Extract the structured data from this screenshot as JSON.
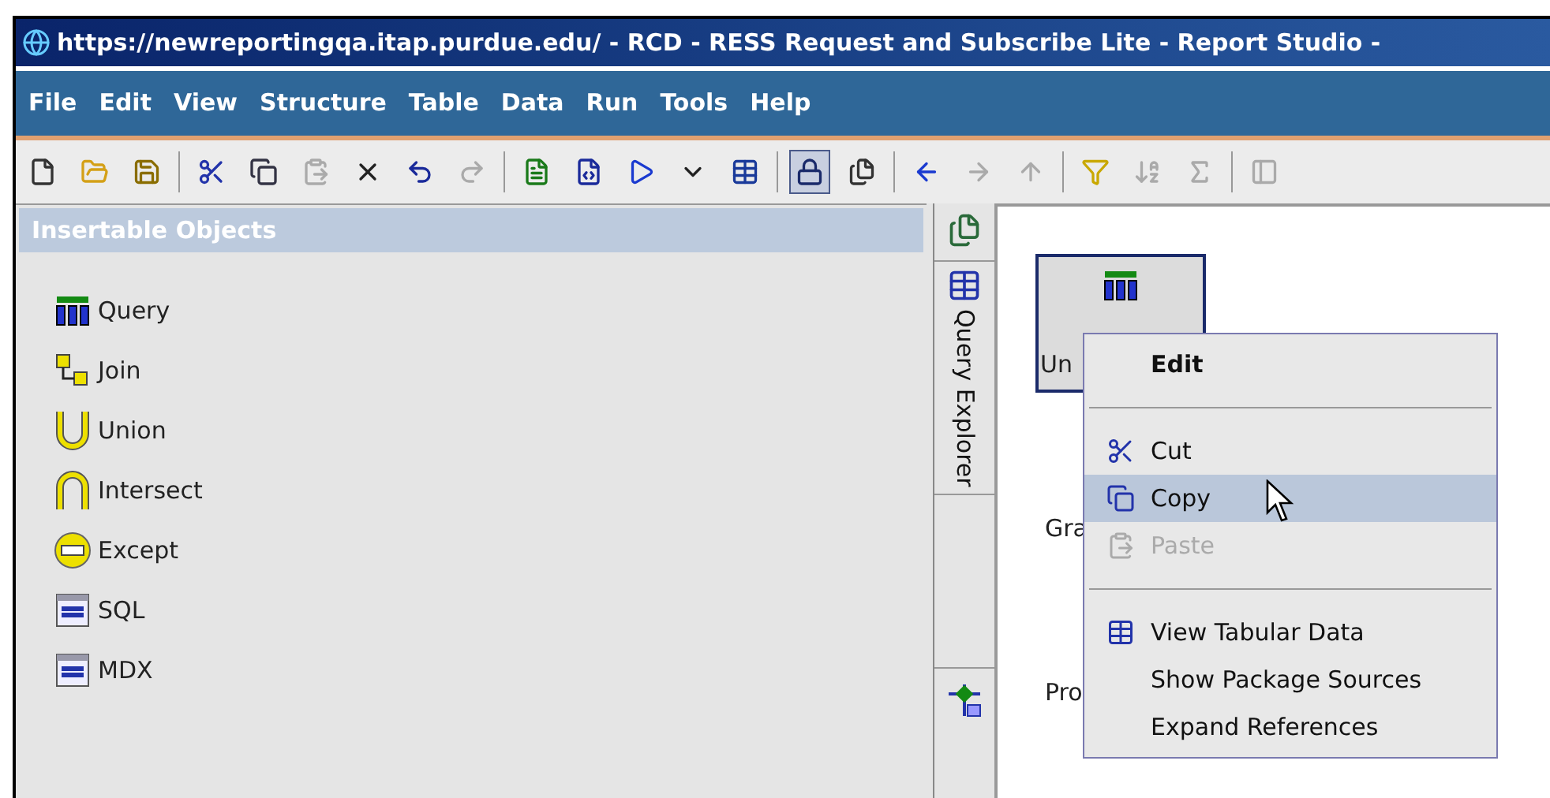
{
  "window": {
    "title": "https://newreportingqa.itap.purdue.edu/ - RCD - RESS Request and Subscribe Lite - Report Studio -"
  },
  "menu_bar": [
    "File",
    "Edit",
    "View",
    "Structure",
    "Table",
    "Data",
    "Run",
    "Tools",
    "Help"
  ],
  "toolbar": [
    {
      "kind": "new",
      "disabled": false,
      "pressed": false
    },
    {
      "kind": "open",
      "disabled": false,
      "pressed": false
    },
    {
      "kind": "save",
      "disabled": false,
      "pressed": false
    },
    {
      "kind": "separator"
    },
    {
      "kind": "cut",
      "disabled": false,
      "pressed": false
    },
    {
      "kind": "copy",
      "disabled": false,
      "pressed": false
    },
    {
      "kind": "paste",
      "disabled": true,
      "pressed": false
    },
    {
      "kind": "delete",
      "disabled": false,
      "pressed": false
    },
    {
      "kind": "undo",
      "disabled": false,
      "pressed": false
    },
    {
      "kind": "redo",
      "disabled": true,
      "pressed": false
    },
    {
      "kind": "separator"
    },
    {
      "kind": "validate",
      "disabled": false,
      "pressed": false
    },
    {
      "kind": "xml",
      "disabled": false,
      "pressed": false
    },
    {
      "kind": "run",
      "disabled": false,
      "pressed": false
    },
    {
      "kind": "dropdown",
      "disabled": false,
      "pressed": false
    },
    {
      "kind": "view-data",
      "disabled": false,
      "pressed": false
    },
    {
      "kind": "separator"
    },
    {
      "kind": "lock",
      "disabled": false,
      "pressed": true
    },
    {
      "kind": "pages",
      "disabled": false,
      "pressed": false
    },
    {
      "kind": "separator"
    },
    {
      "kind": "back",
      "disabled": false,
      "pressed": false
    },
    {
      "kind": "forward",
      "disabled": true,
      "pressed": false
    },
    {
      "kind": "up",
      "disabled": true,
      "pressed": false
    },
    {
      "kind": "separator"
    },
    {
      "kind": "filter",
      "disabled": false,
      "pressed": false
    },
    {
      "kind": "sort",
      "disabled": true,
      "pressed": false
    },
    {
      "kind": "sum",
      "disabled": true,
      "pressed": false
    },
    {
      "kind": "separator"
    },
    {
      "kind": "panel",
      "disabled": true,
      "pressed": false
    }
  ],
  "insertable_objects": {
    "title": "Insertable Objects",
    "items": [
      {
        "kind": "query",
        "label": "Query"
      },
      {
        "kind": "join",
        "label": "Join"
      },
      {
        "kind": "union",
        "label": "Union"
      },
      {
        "kind": "intersect",
        "label": "Intersect"
      },
      {
        "kind": "except",
        "label": "Except"
      },
      {
        "kind": "sql",
        "label": "SQL"
      },
      {
        "kind": "mdx",
        "label": "MDX"
      }
    ]
  },
  "side_tabs": {
    "query_explorer": "Query Explorer"
  },
  "canvas": {
    "labels": [
      "Un",
      "Gra",
      "Pro"
    ]
  },
  "context_menu": [
    {
      "kind": "plain",
      "label": "Edit",
      "default": true,
      "selected": false,
      "disabled": false
    },
    {
      "kind": "separator"
    },
    {
      "kind": "cut",
      "label": "Cut",
      "default": false,
      "selected": false,
      "disabled": false
    },
    {
      "kind": "copy",
      "label": "Copy",
      "default": false,
      "selected": true,
      "disabled": false
    },
    {
      "kind": "paste",
      "label": "Paste",
      "default": false,
      "selected": false,
      "disabled": true
    },
    {
      "kind": "separator"
    },
    {
      "kind": "view-data",
      "label": "View Tabular Data",
      "default": false,
      "selected": false,
      "disabled": false
    },
    {
      "kind": "plain",
      "label": "Show Package Sources",
      "default": false,
      "selected": false,
      "disabled": false
    },
    {
      "kind": "plain",
      "label": "Expand References",
      "default": false,
      "selected": false,
      "disabled": false
    }
  ]
}
